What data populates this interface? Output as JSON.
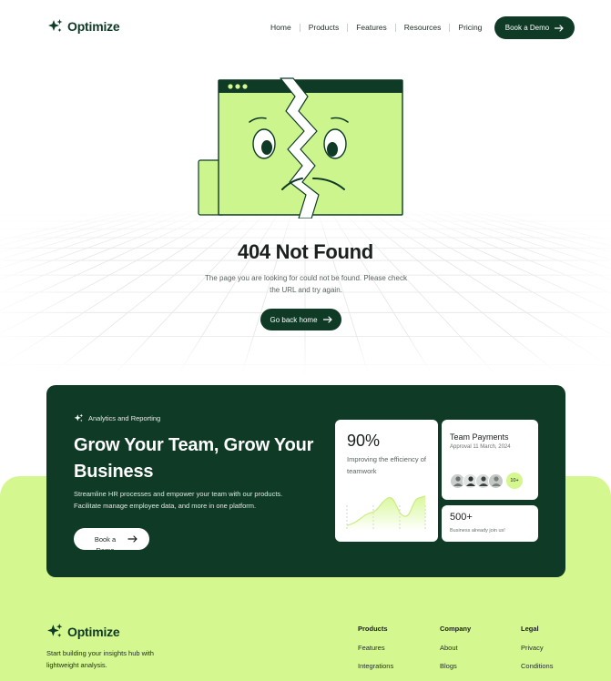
{
  "header": {
    "brand": "Optimize",
    "nav": [
      "Home",
      "Products",
      "Features",
      "Resources",
      "Pricing"
    ],
    "cta": "Book a Demo"
  },
  "error": {
    "title": "404 Not Found",
    "description": "The page you are looking for could not be found. Please check the URL and try again.",
    "back_button": "Go back home"
  },
  "promo": {
    "tag": "Analytics and Reporting",
    "heading": "Grow Your Team, Grow Your Business",
    "body": "Streamline HR processes and empower your team with our products. Facilitate manage employee data, and more in one platform.",
    "button": "Book a Demo",
    "efficiency_card": {
      "value": "90%",
      "label": "Improving the efficiency of teamwork"
    },
    "payments_card": {
      "title": "Team Payments",
      "subtitle": "Approval 11 March, 2024",
      "more_badge": "10+"
    },
    "business_card": {
      "value": "500+",
      "label": "Business already join us!"
    }
  },
  "footer": {
    "brand": "Optimize",
    "tagline": "Start building your insights hub with lightweight analysis.",
    "columns": [
      {
        "heading": "Products",
        "links": [
          "Features",
          "Integrations"
        ]
      },
      {
        "heading": "Company",
        "links": [
          "About",
          "Blogs"
        ]
      },
      {
        "heading": "Legal",
        "links": [
          "Privacy",
          "Conditions"
        ]
      }
    ]
  },
  "colors": {
    "primary": "#0f3a26",
    "accent": "#d4f78f",
    "illustration_fill": "#ccf58e"
  },
  "icons": [
    "sparkle-icon",
    "arrow-right-icon",
    "broken-browser-illustration"
  ]
}
